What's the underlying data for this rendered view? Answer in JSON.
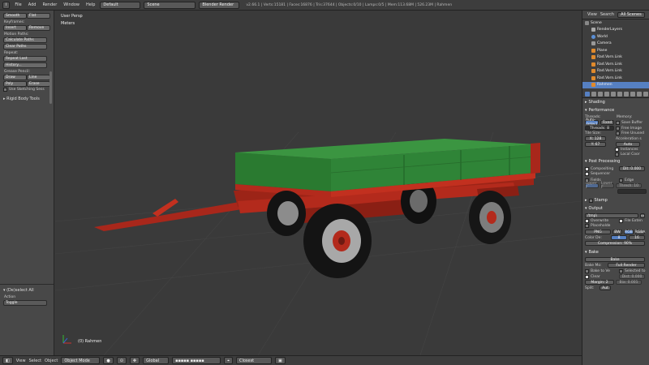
{
  "topbar": {
    "menus": [
      "File",
      "Add",
      "Render",
      "Window",
      "Help"
    ],
    "layout": "Default",
    "scene": "Scene",
    "engine": "Blender Render",
    "stats": "v2.66.1 | Verts:15181 | Faces:16876 | Tris:37644 | Objects:0/10 | Lamps:0/5 | Mem:113.68M | 526.23M | Rahmen"
  },
  "toolshelf": {
    "shading_buttons": [
      "Smooth",
      "Flat"
    ],
    "keyframes_title": "Keyframes:",
    "keyframe_buttons": [
      "Insert",
      "Remove"
    ],
    "motion_title": "Motion Paths:",
    "motion_buttons": [
      "Calculate Paths",
      "Clear Paths"
    ],
    "repeat_title": "Repeat:",
    "repeat_buttons": [
      "Repeat Last",
      "History..."
    ],
    "grease_title": "Grease Pencil:",
    "grease_row1": [
      "Draw",
      "Line"
    ],
    "grease_row2": [
      "Poly",
      "Erase"
    ],
    "sketch_label": "Use Sketching Sess",
    "rigid_title": "Rigid Body Tools",
    "operator_title": "(De)select All",
    "action_label": "Action",
    "action_value": "Toggle"
  },
  "viewport": {
    "view_label": "User Persp",
    "units_label": "Meters",
    "object_label": "(0) Rahmen"
  },
  "bottombar": {
    "menus": [
      "View",
      "Select",
      "Object"
    ],
    "mode": "Object Mode",
    "pivot": "Global",
    "snap": "Closest"
  },
  "outliner": {
    "header": [
      "View",
      "Search",
      "All Scenes"
    ],
    "items": [
      "Scene",
      "RenderLayers",
      "World",
      "Camera",
      "Plane",
      "Rad.Vorn.Link",
      "Rad.Vorn.Link",
      "Rad.Vorn.Link",
      "Rad.Vorn.Link",
      "Rahmen"
    ]
  },
  "properties": {
    "shading": "Shading",
    "performance": "Performance",
    "threads": "Threads:",
    "memory": "Memory:",
    "auto_detect": "Auto-detect",
    "fixed": "Fixed",
    "threads_val": "Threads: 8",
    "save_buffers": "Save Buffer",
    "free_image": "Free Image",
    "free_unused": "Free Unused",
    "tile_size": "Tile Size:",
    "tile_x": "X: 128",
    "tile_y": "Y: 67",
    "accel": "Acceleration s",
    "accel_val": "Auto",
    "instances": "Instances",
    "local_coords": "Local Coor",
    "post_processing": "Post Processing",
    "compositing": "Compositing",
    "dither": "Dit: 0.000",
    "sequencer": "Sequencer",
    "fields": "Fields",
    "edge": "Edge",
    "upper_first": "Upper F",
    "lower_first": "Lower F",
    "threshold": "Thresh: 10",
    "stamp": "Stamp",
    "output": "Output",
    "path": "/tmp\\",
    "overwrite": "Overwrite",
    "file_ext": "File Exten",
    "placeholders": "Placeholde",
    "format": "PNG",
    "bw": "BW",
    "rgb": "RGB",
    "rgba": "RGBA",
    "color_depth": "Color De:",
    "depth8": "8",
    "depth16": "16",
    "compression": "Compression: 90%",
    "bake": "Bake",
    "bake_button": "Bake",
    "bake_mode_label": "Bake Mo:",
    "bake_mode": "Full Render",
    "bake_to_vc": "Bake to Ve",
    "selected_to_active": "Selected to",
    "clear": "Clear",
    "dist": "Dist: 0.000",
    "margin": "Margin: 2",
    "bias": "Bia: 0.001",
    "split": "Split:",
    "split_val": "Aut"
  },
  "colors": {
    "trailer_green": "#2f7d35",
    "trailer_red": "#b3281c",
    "accent_blue": "#5680c2"
  }
}
